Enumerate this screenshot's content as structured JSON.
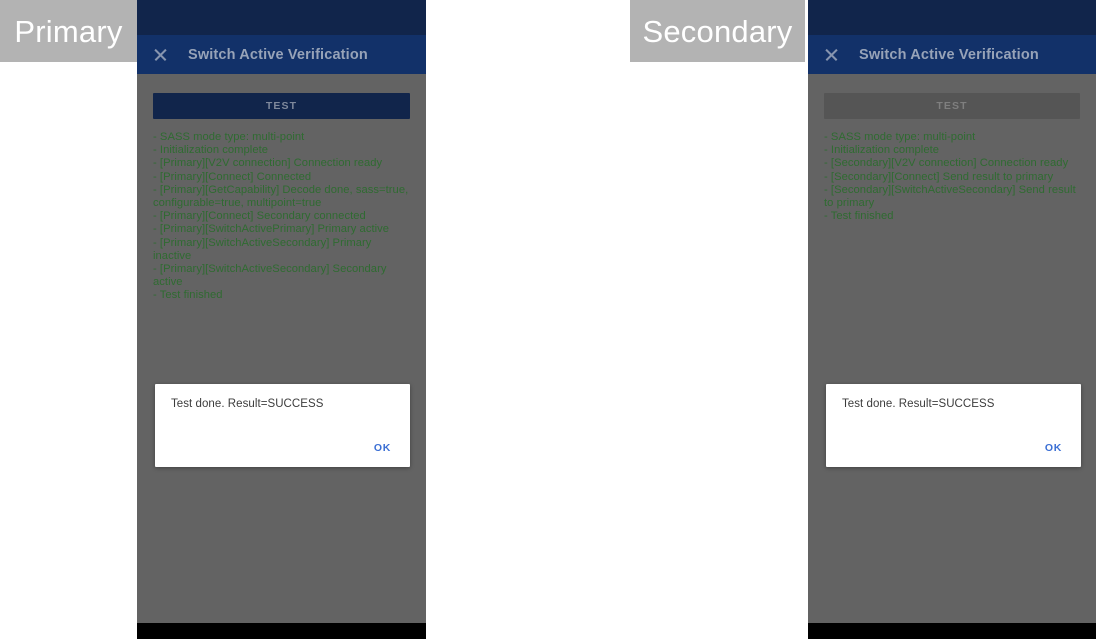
{
  "captions": {
    "primary": "Primary",
    "secondary": "Secondary"
  },
  "colors": {
    "status_bar": "#11254b",
    "app_bar": "#123169",
    "scrim_background": "#636363",
    "log_text": "#2f6b31",
    "button_enabled": "#11254b",
    "button_disabled": "#555555",
    "dialog_action": "#3b6fd4",
    "caption_chip": "#b3b3b3",
    "nav_bar": "#000000"
  },
  "primary_device": {
    "app_bar": {
      "close_icon": "close-icon",
      "title": "Switch Active Verification"
    },
    "test_button": {
      "label": "TEST",
      "state": "enabled"
    },
    "log_lines": [
      "- SASS mode type: multi-point",
      "- Initialization complete",
      "- [Primary][V2V connection] Connection ready",
      "- [Primary][Connect] Connected",
      "- [Primary][GetCapability] Decode done, sass=true, configurable=true, multipoint=true",
      "- [Primary][Connect] Secondary connected",
      "- [Primary][SwitchActivePrimary] Primary active",
      "- [Primary][SwitchActiveSecondary] Primary inactive",
      "- [Primary][SwitchActiveSecondary] Secondary active",
      "- Test finished"
    ],
    "dialog": {
      "message": "Test done. Result=SUCCESS",
      "ok_label": "OK"
    }
  },
  "secondary_device": {
    "app_bar": {
      "close_icon": "close-icon",
      "title": "Switch Active Verification"
    },
    "test_button": {
      "label": "TEST",
      "state": "disabled"
    },
    "log_lines": [
      "- SASS mode type: multi-point",
      "- Initialization complete",
      "- [Secondary][V2V connection] Connection ready",
      "- [Secondary][Connect] Send result to primary",
      "- [Secondary][SwitchActiveSecondary] Send result to primary",
      "- Test finished"
    ],
    "dialog": {
      "message": "Test done. Result=SUCCESS",
      "ok_label": "OK"
    }
  }
}
